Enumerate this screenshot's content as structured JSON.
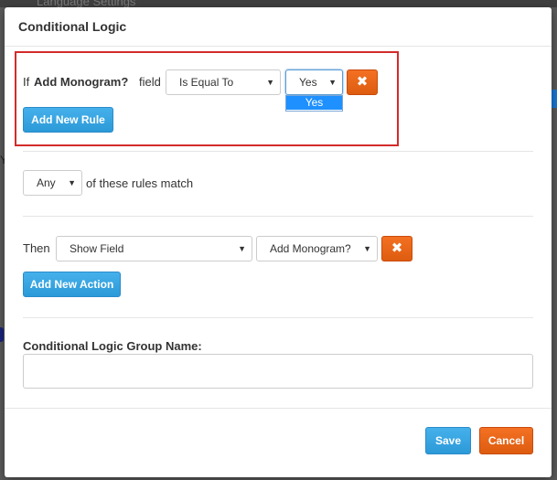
{
  "backdrop": {
    "top_text": "Language Settings",
    "left_text": "Y"
  },
  "modal": {
    "title": "Conditional Logic",
    "rule": {
      "prefix": "If",
      "field_name": "Add Monogram?",
      "field_suffix": "field",
      "operator_value": "Is Equal To",
      "value_selected": "Yes",
      "value_options": [
        "Yes"
      ],
      "delete_label": "✖",
      "add_rule_label": "Add New Rule"
    },
    "match": {
      "mode_value": "Any",
      "suffix": "of these rules match"
    },
    "action": {
      "prefix": "Then",
      "action_value": "Show Field",
      "target_value": "Add Monogram?",
      "delete_label": "✖",
      "add_action_label": "Add New Action"
    },
    "group_name": {
      "label": "Conditional Logic Group Name:",
      "value": ""
    },
    "footer": {
      "save_label": "Save",
      "cancel_label": "Cancel"
    }
  },
  "colors": {
    "primary_button": "#2c9ad8",
    "danger_button": "#dd5c0f",
    "highlight_border": "#d22b2b",
    "dropdown_highlight": "#1e90ff"
  }
}
